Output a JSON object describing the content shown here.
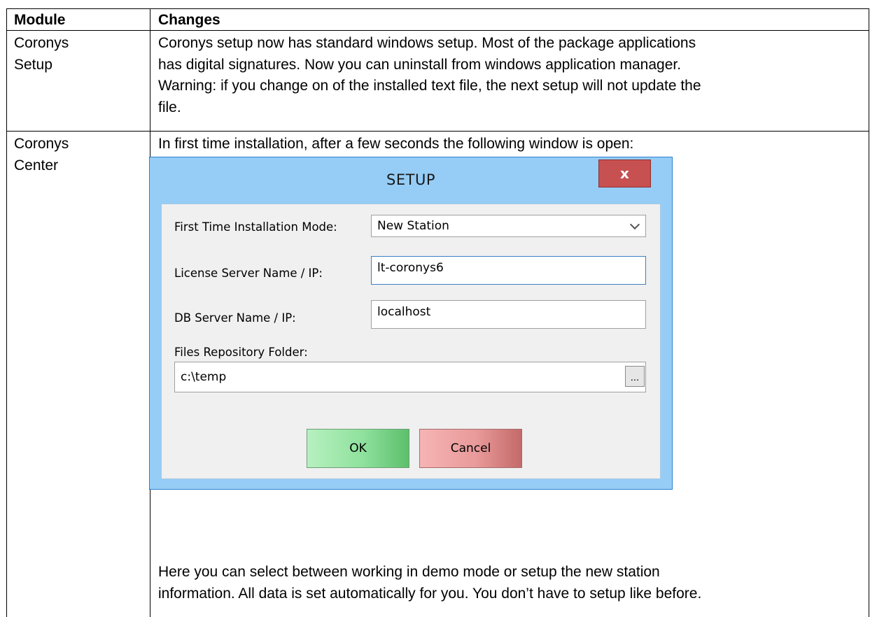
{
  "table": {
    "headers": {
      "module": "Module",
      "changes": "Changes"
    },
    "rows": [
      {
        "module_lines": [
          "Coronys",
          "Setup"
        ],
        "change_lines": [
          "Coronys setup now has standard windows setup. Most of the package applications",
          "has digital signatures. Now you can uninstall from windows application manager.",
          "Warning: if you change on of the installed text file, the next setup will not update the",
          "file."
        ]
      },
      {
        "module_lines": [
          "Coronys",
          "Center"
        ],
        "intro": "In first time installation, after a few seconds the following window is open:",
        "after_lines": [
          "Here you can select between working in demo mode or setup the new station",
          "information. All data is set automatically for you. You don’t have to setup like before."
        ]
      }
    ]
  },
  "dialog": {
    "title": "SETUP",
    "close_label": "x",
    "mode_label": "First Time Installation Mode:",
    "mode_value": "New Station",
    "license_label": "License Server Name / IP:",
    "license_value": "lt-coronys6",
    "db_label": "DB Server Name / IP:",
    "db_value": "localhost",
    "repo_label": "Files Repository Folder:",
    "repo_value": "c:\\temp",
    "browse_label": "...",
    "ok_label": "OK",
    "cancel_label": "Cancel"
  },
  "colors": {
    "dialog_frame": "#95cdf6",
    "close_button": "#c75050",
    "ok_button": "#8fe19d",
    "cancel_button": "#e99a9a"
  }
}
